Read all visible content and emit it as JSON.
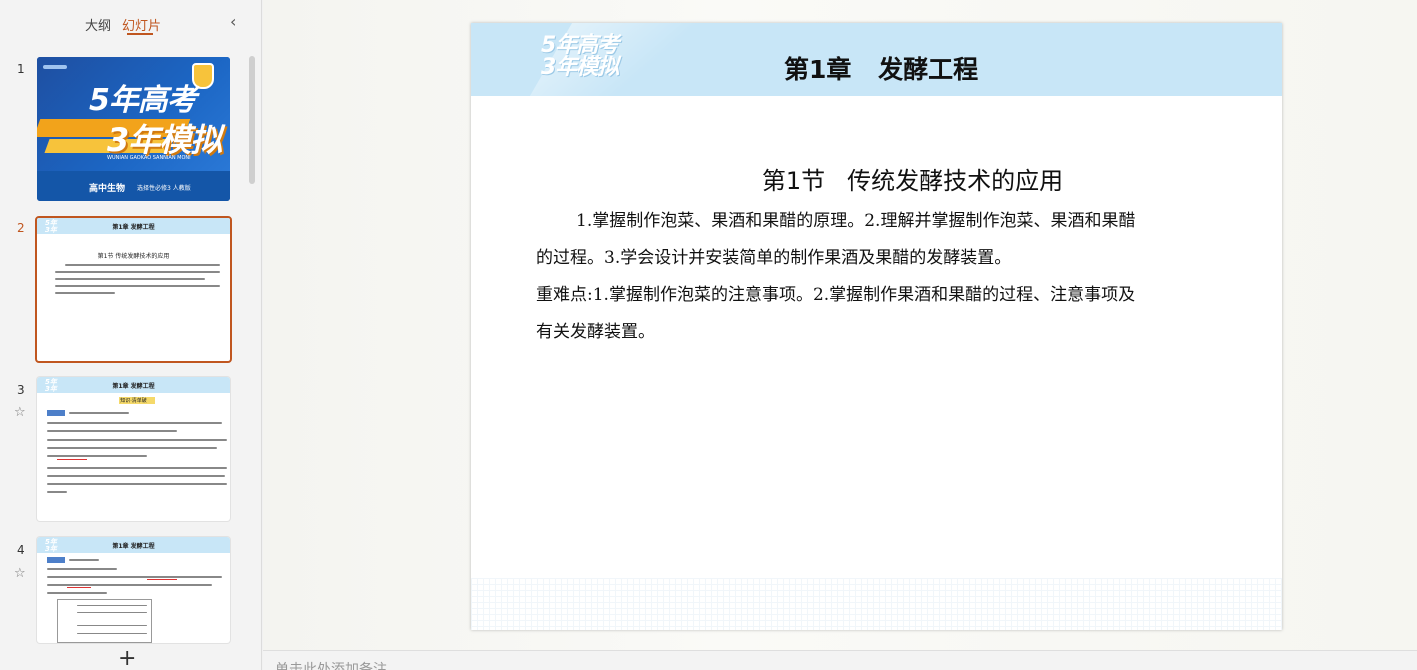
{
  "panel": {
    "tabs": [
      {
        "label": "大纲"
      },
      {
        "label": "幻灯片"
      }
    ],
    "active_tab": "幻灯片"
  },
  "thumbnails": [
    {
      "number": "1",
      "cover_title1": "5年高考",
      "cover_title2": "3年模拟",
      "cover_subtitle": "WUNIAN GAOKAO SANNIAN MONI",
      "cover_bottom_a": "高中生物",
      "cover_bottom_b": "选择性必修3 人教版"
    },
    {
      "number": "2",
      "header_title": "第1章  发酵工程",
      "section": "第1节  传统发酵技术的应用"
    },
    {
      "number": "3",
      "header_title": "第1章  发酵工程",
      "tag": "知识·清单破"
    },
    {
      "number": "4",
      "header_title": "第1章  发酵工程"
    }
  ],
  "slide": {
    "logo_line1": "5年高考",
    "logo_line2": "3年模拟",
    "chapter_num": "第1章",
    "chapter_name": "发酵工程",
    "section_num": "第1节",
    "section_name": "传统发酵技术的应用",
    "para1_line1": "1.掌握制作泡菜、果酒和果醋的原理。2.理解并掌握制作泡菜、果酒和果醋",
    "para1_line2": "的过程。3.学会设计并安装简单的制作果酒及果醋的发酵装置。",
    "para2_line1": "重难点:1.掌握制作泡菜的注意事项。2.掌握制作果酒和果醋的过程、注意事项及",
    "para2_line2": "有关发酵装置。"
  },
  "notes": {
    "placeholder": "单击此处添加备注"
  },
  "colors": {
    "accent": "#c0561f",
    "slide_header": "#c8e6f7",
    "cover_blue": "#1f5fb5",
    "cover_orange": "#f2a31b"
  },
  "icons": [
    "chevron-left-icon",
    "star-icon",
    "plus-icon"
  ]
}
